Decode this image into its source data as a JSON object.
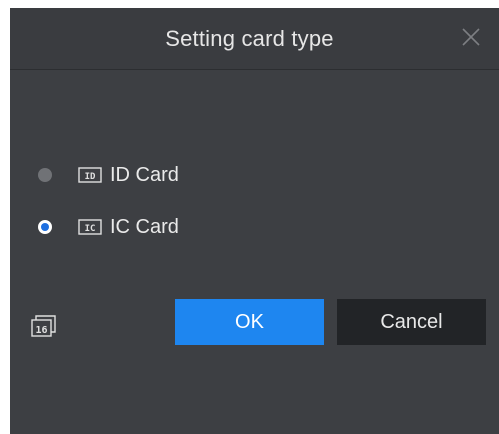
{
  "dialog": {
    "title": "Setting card type",
    "close_icon": "close-icon"
  },
  "options": [
    {
      "icon_text": "ID",
      "label": "ID Card",
      "selected": false
    },
    {
      "icon_text": "IC",
      "label": "IC Card",
      "selected": true
    }
  ],
  "corner": {
    "icon": "card-16-icon",
    "icon_text": "16"
  },
  "buttons": {
    "ok_label": "OK",
    "cancel_label": "Cancel"
  },
  "colors": {
    "dialog_bg": "#3d3f43",
    "accent": "#1e86f0",
    "cancel_bg": "#222427",
    "radio_selected": "#1e6fe0"
  }
}
